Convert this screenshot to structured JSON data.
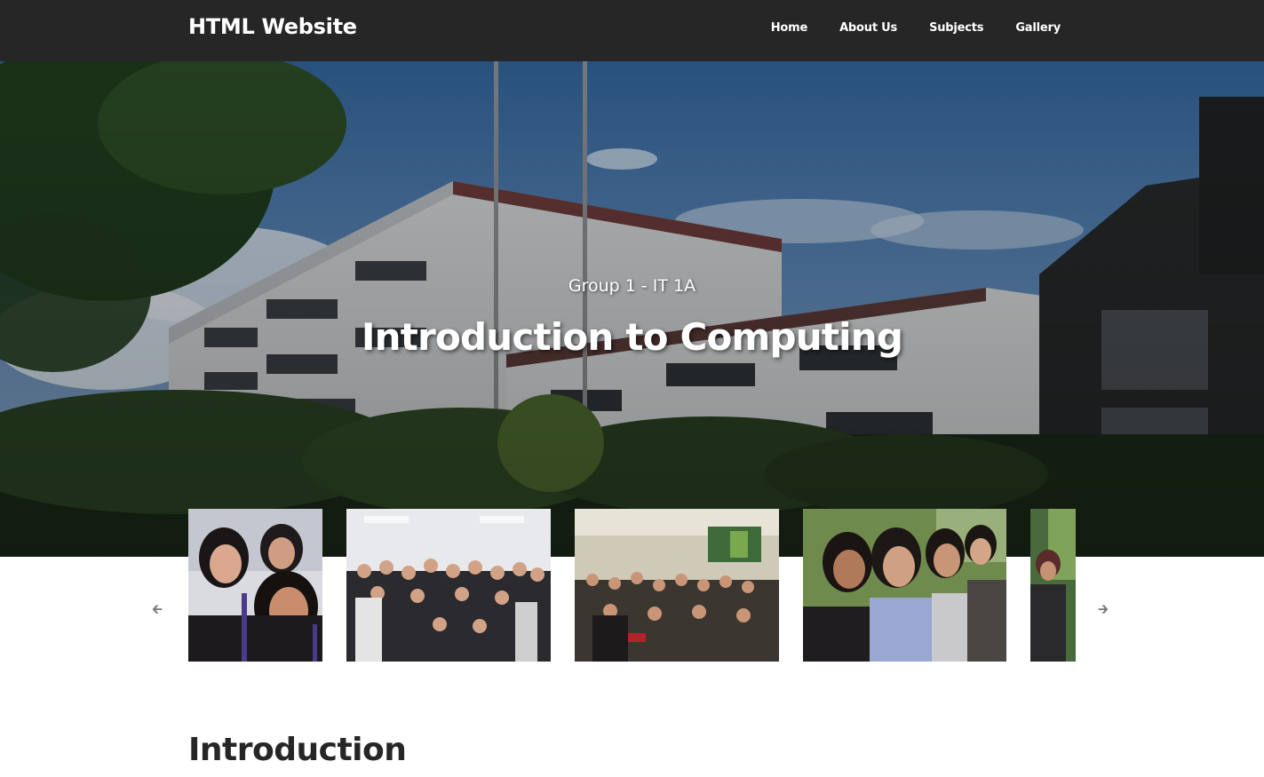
{
  "site": {
    "brand": "HTML Website"
  },
  "nav": {
    "items": [
      "Home",
      "About Us",
      "Subjects",
      "Gallery"
    ]
  },
  "hero": {
    "subtitle": "Group 1 - IT 1A",
    "title": "Introduction to Computing"
  },
  "carousel": {
    "slides": [
      {
        "name": "group-selfie-photo"
      },
      {
        "name": "class-group-photo"
      },
      {
        "name": "classroom-group-photo"
      },
      {
        "name": "friends-selfie-photo"
      },
      {
        "name": "student-photo"
      }
    ],
    "prev_icon": "arrow-left-icon",
    "next_icon": "arrow-right-icon"
  },
  "intro": {
    "heading": "Introduction"
  },
  "colors": {
    "navbar": "#262626",
    "text": "#262626",
    "hero_text": "#ffffff"
  }
}
